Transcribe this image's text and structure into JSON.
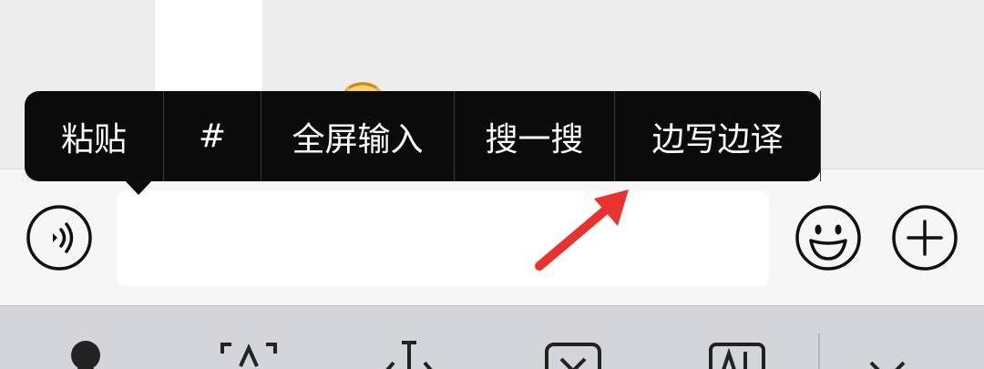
{
  "context_menu": {
    "items": [
      {
        "label": "粘贴"
      },
      {
        "label": "#"
      },
      {
        "label": "全屏输入"
      },
      {
        "label": "搜一搜"
      },
      {
        "label": "边写边译"
      }
    ]
  },
  "input": {
    "value": "",
    "placeholder": ""
  },
  "icons": {
    "voice": "voice-icon",
    "emoji": "emoji-icon",
    "plus": "plus-icon",
    "annotation_arrow": "red-arrow-icon"
  },
  "keyboard_toolbar": {
    "tools": [
      "globe-icon",
      "text-scan-icon",
      "cursor-move-icon",
      "clear-icon",
      "font-style-icon",
      "collapse-keyboard-icon"
    ]
  },
  "colors": {
    "menu_background": "#0b0b0b",
    "menu_text": "#ffffff",
    "annotation_arrow": "#e8322f",
    "input_bar": "#f6f6f6",
    "keyboard_toolbar": "#d3d5da"
  }
}
